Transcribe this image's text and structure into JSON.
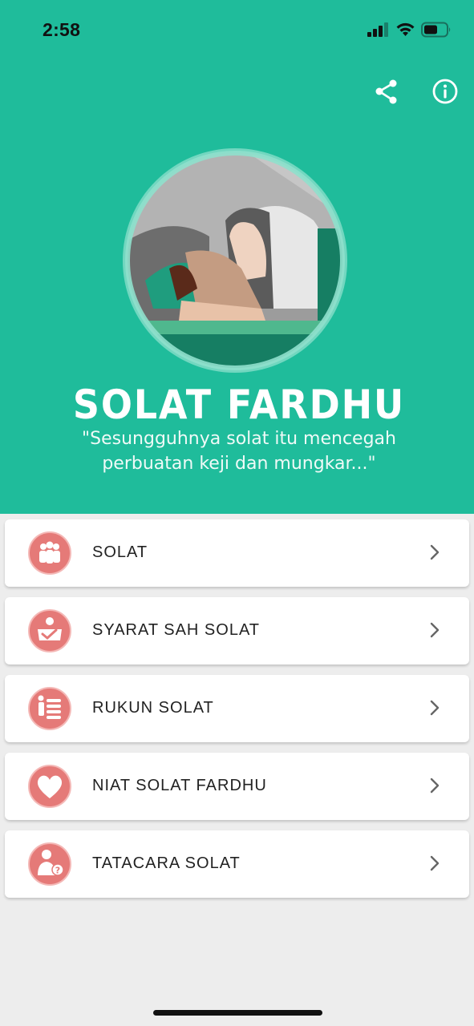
{
  "status_bar": {
    "time": "2:58",
    "icons": [
      "cellular-signal-icon",
      "wifi-icon",
      "battery-icon"
    ]
  },
  "header": {
    "actions": [
      {
        "name": "share-icon"
      },
      {
        "name": "info-icon"
      }
    ],
    "hero_image": "person-prostrating-in-prayer",
    "title": "SOLAT FARDHU",
    "tagline_line1": "\"Sesungguhnya solat itu mencegah",
    "tagline_line2": "perbuatan keji dan mungkar...\""
  },
  "menu": {
    "items": [
      {
        "label": "SOLAT",
        "icon": "group-people-icon"
      },
      {
        "label": "SYARAT SAH SOLAT",
        "icon": "checklist-person-icon"
      },
      {
        "label": "RUKUN SOLAT",
        "icon": "list-icon"
      },
      {
        "label": "NIAT SOLAT FARDHU",
        "icon": "heart-icon"
      },
      {
        "label": "TATACARA SOLAT",
        "icon": "person-question-icon"
      }
    ]
  },
  "colors": {
    "header_bg": "#1fbc9b",
    "icon_bg": "#e57a78",
    "page_bg": "#ededed"
  }
}
